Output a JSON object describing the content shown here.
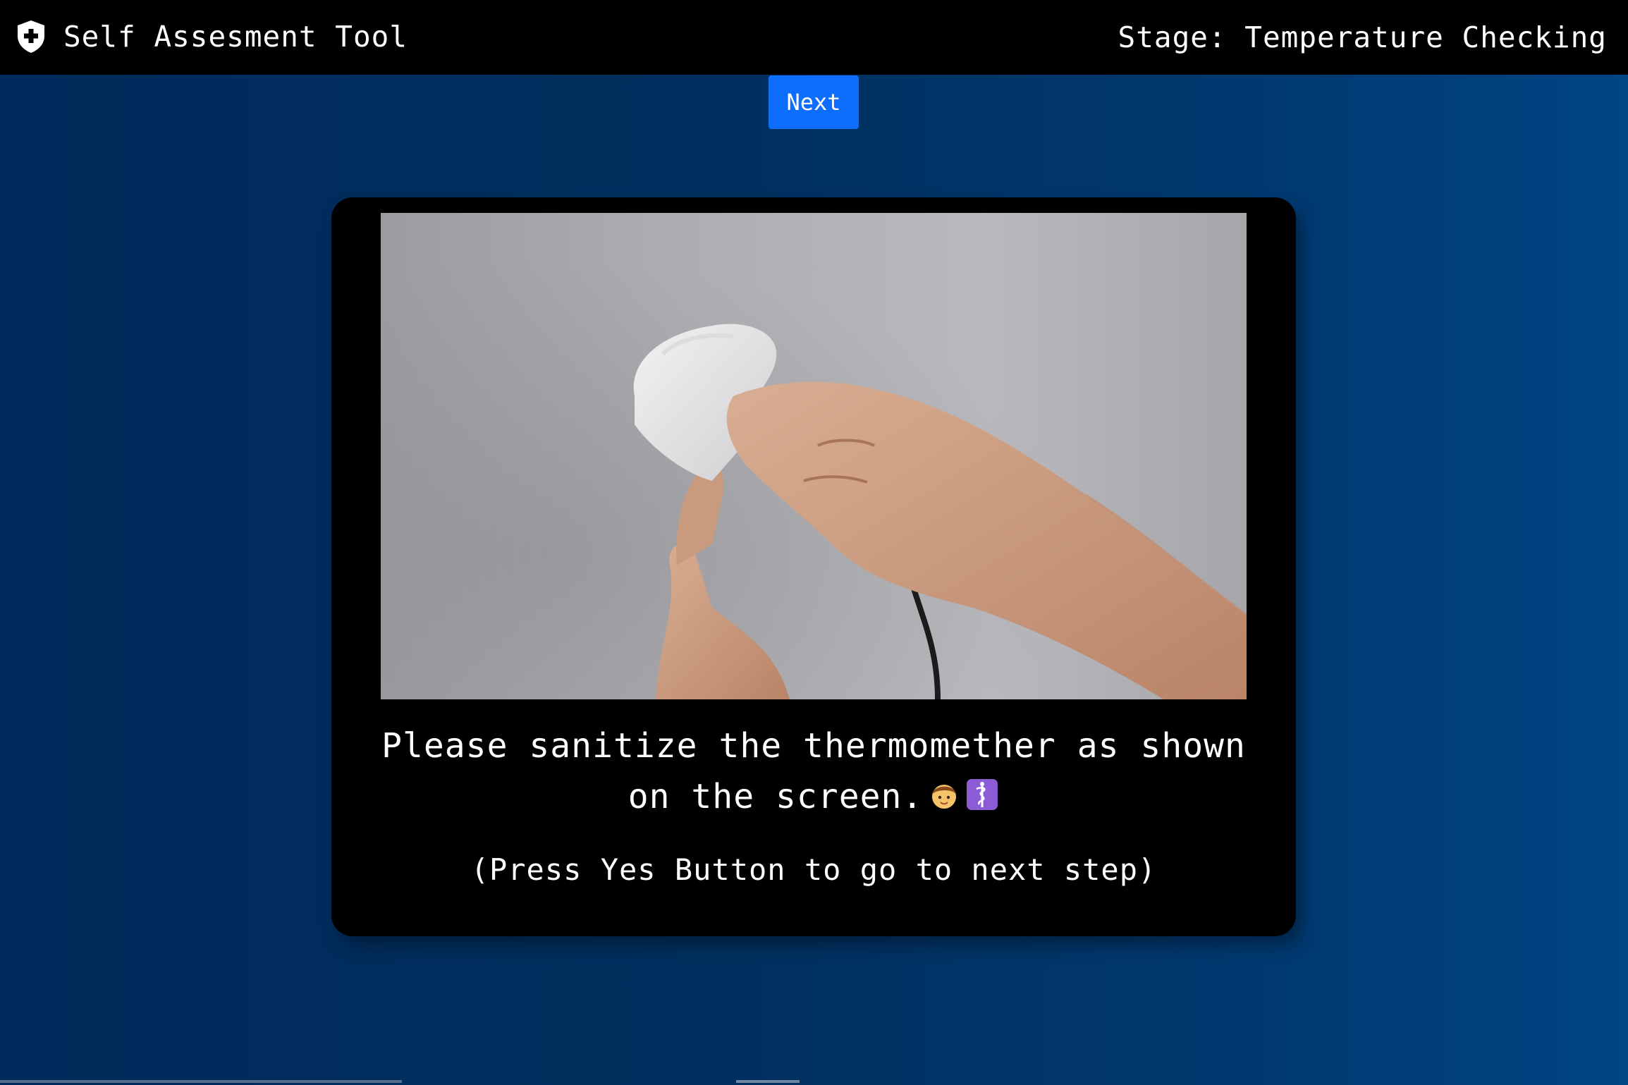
{
  "header": {
    "app_title": "Self Assesment Tool",
    "stage_text": "Stage: Temperature Checking",
    "logo_icon": "shield-plus-icon"
  },
  "actions": {
    "next_label": "Next",
    "next_color": "#0d6efd"
  },
  "card": {
    "media_description_icon": "sanitize-thermometer-animation",
    "instruction_text": "Please sanitize the thermomether as shown on the screen.",
    "instruction_emojis": [
      "boy-emoji",
      "medical-symbol-emoji"
    ],
    "hint_text": "(Press Yes Button to go to next step)"
  },
  "theme": {
    "navbar_bg": "#000000",
    "page_bg": "#002b5c",
    "card_bg": "#000000",
    "text": "#ffffff"
  }
}
